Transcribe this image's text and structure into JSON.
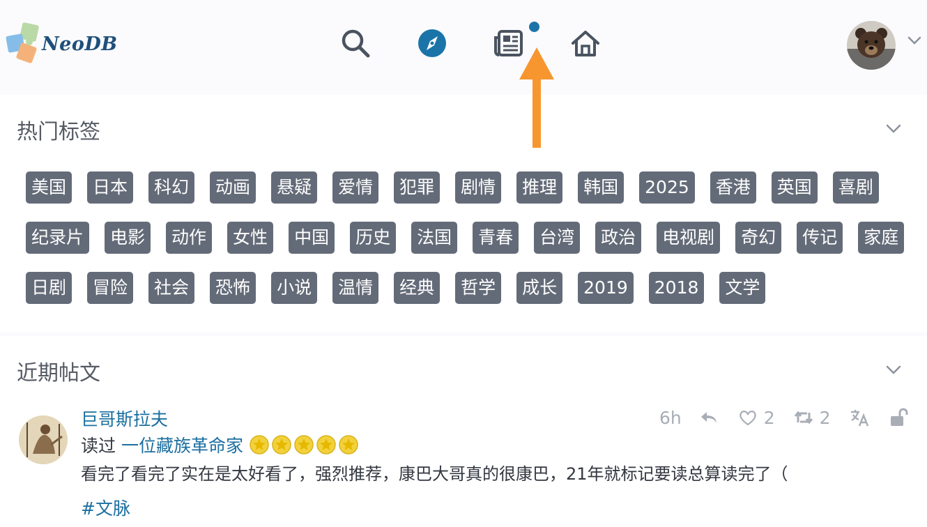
{
  "header": {
    "logo_text": "NeoDB",
    "nav": [
      {
        "icon": "search-icon"
      },
      {
        "icon": "compass-icon"
      },
      {
        "icon": "newspaper-icon"
      },
      {
        "icon": "home-icon"
      }
    ],
    "colors": {
      "accent": "#1b74a8",
      "arrow": "#f7962f",
      "tag_bg": "#646b78"
    }
  },
  "tags_section": {
    "title": "热门标签",
    "tags": [
      "美国",
      "日本",
      "科幻",
      "动画",
      "悬疑",
      "爱情",
      "犯罪",
      "剧情",
      "推理",
      "韩国",
      "2025",
      "香港",
      "英国",
      "喜剧",
      "纪录片",
      "电影",
      "动作",
      "女性",
      "中国",
      "历史",
      "法国",
      "青春",
      "台湾",
      "政治",
      "电视剧",
      "奇幻",
      "传记",
      "家庭",
      "日剧",
      "冒险",
      "社会",
      "恐怖",
      "小说",
      "温情",
      "经典",
      "哲学",
      "成长",
      "2019",
      "2018",
      "文学"
    ]
  },
  "posts_section": {
    "title": "近期帖文",
    "post": {
      "author": "巨哥斯拉夫",
      "action": "读过",
      "work_title": "一位藏族革命家",
      "rating_stars": 5,
      "content": "看完了看完了实在是太好看了，强烈推荐，康巴大哥真的很康巴，21年就标记要读总算读完了（",
      "hashtag": "#文脉",
      "time": "6h",
      "likes": "2",
      "boosts": "2"
    }
  }
}
